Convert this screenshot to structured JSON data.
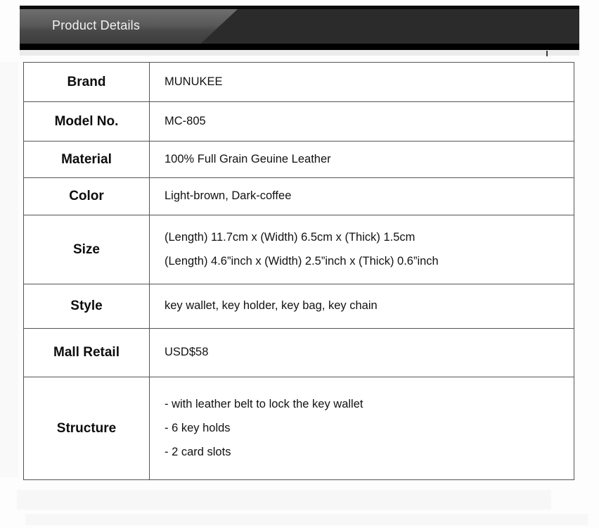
{
  "header": {
    "title": "Product Details",
    "tab_color": "#5a5a5a",
    "bar_color": "#2b2b2b"
  },
  "spec_table": {
    "rows": [
      {
        "label": "Brand",
        "values": [
          "MUNUKEE"
        ]
      },
      {
        "label": "Model No.",
        "values": [
          "MC-805"
        ]
      },
      {
        "label": "Material",
        "values": [
          "100% Full Grain  Geuine Leather"
        ]
      },
      {
        "label": "Color",
        "values": [
          "Light-brown, Dark-coffee"
        ]
      },
      {
        "label": "Size",
        "values": [
          "(Length) 11.7cm x (Width) 6.5cm x (Thick) 1.5cm",
          "(Length) 4.6”inch x (Width) 2.5”inch x (Thick) 0.6”inch"
        ]
      },
      {
        "label": "Style",
        "values": [
          "key wallet, key holder, key bag, key chain"
        ]
      },
      {
        "label": "Mall Retail",
        "values": [
          "USD$58"
        ]
      },
      {
        "label": "Structure",
        "values": [
          "- with leather belt to lock the key wallet",
          "- 6 key holds",
          "- 2 card slots"
        ]
      }
    ]
  }
}
